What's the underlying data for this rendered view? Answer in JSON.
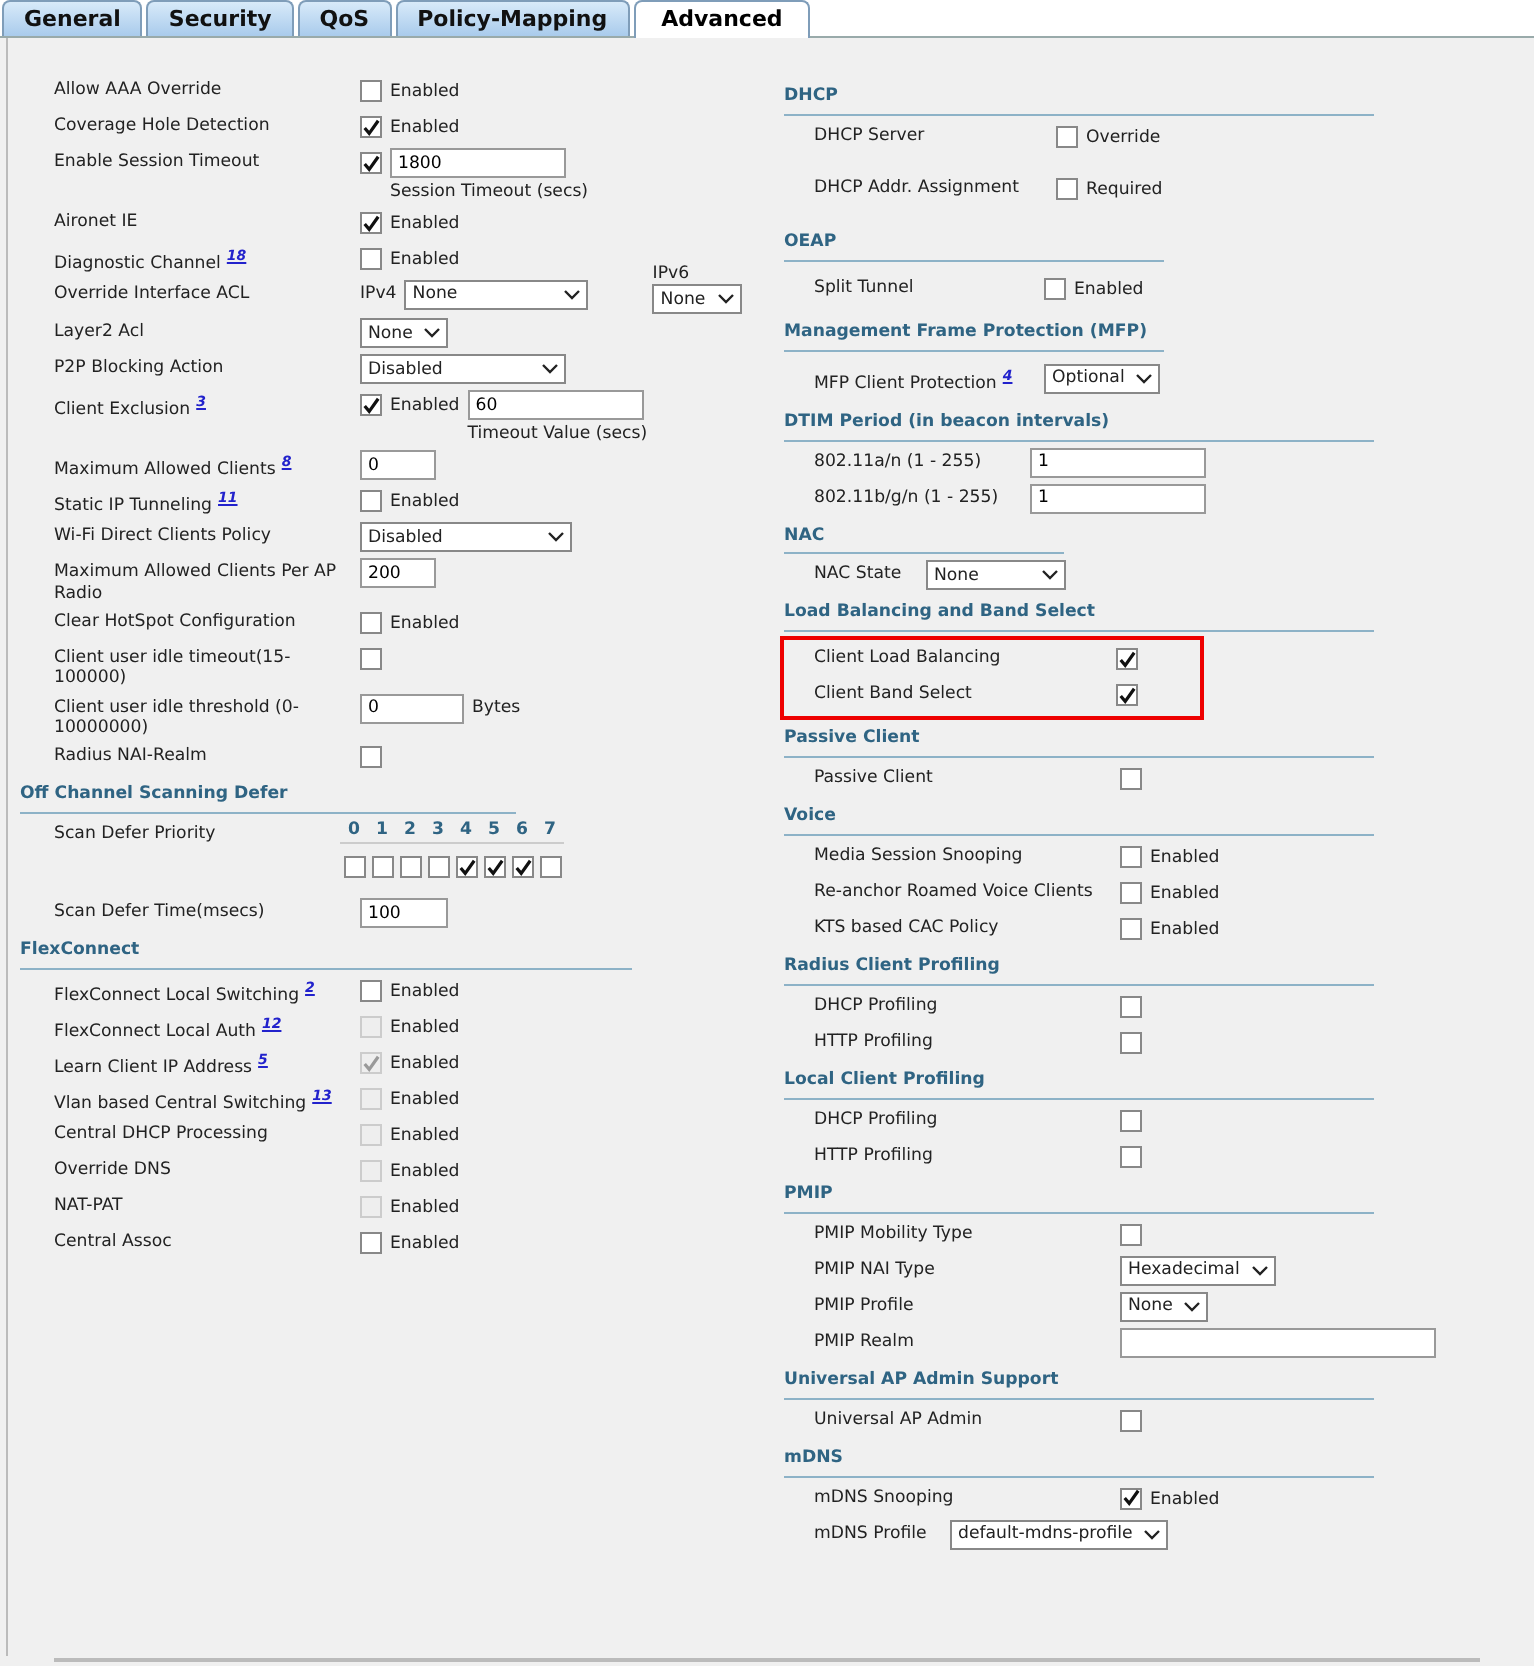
{
  "tabs": [
    {
      "label": "General",
      "selected": false
    },
    {
      "label": "Security",
      "selected": false
    },
    {
      "label": "QoS",
      "selected": false
    },
    {
      "label": "Policy-Mapping",
      "selected": false
    },
    {
      "label": "Advanced",
      "selected": true
    }
  ],
  "left_sections": [
    {
      "rows": [
        {
          "label": "Allow AAA Override",
          "controls": [
            {
              "kind": "checkbox",
              "checked": false,
              "text": "Enabled"
            }
          ]
        },
        {
          "label": "Coverage Hole Detection",
          "controls": [
            {
              "kind": "checkbox",
              "checked": true,
              "text": "Enabled"
            }
          ]
        },
        {
          "label": "Enable Session Timeout",
          "controls": [
            {
              "kind": "checkbox",
              "checked": true
            },
            {
              "kind": "input",
              "value": "1800",
              "caption": "Session Timeout (secs)"
            }
          ]
        },
        {
          "label": "Aironet IE",
          "controls": [
            {
              "kind": "checkbox",
              "checked": true,
              "text": "Enabled"
            }
          ]
        },
        {
          "label": "Diagnostic Channel",
          "note": "18",
          "controls": [
            {
              "kind": "checkbox",
              "checked": false,
              "text": "Enabled"
            }
          ]
        },
        {
          "label": "Override Interface ACL",
          "controls": [
            {
              "kind": "select",
              "prefix": "IPv4",
              "value": "None"
            },
            {
              "kind": "select",
              "caption_above": "IPv6",
              "value": "None"
            }
          ]
        },
        {
          "label": "Layer2 Acl",
          "controls": [
            {
              "kind": "select",
              "value": "None"
            }
          ]
        },
        {
          "label": "P2P Blocking Action",
          "controls": [
            {
              "kind": "select",
              "value": "Disabled"
            }
          ]
        },
        {
          "label": "Client Exclusion",
          "note": "3",
          "controls": [
            {
              "kind": "checkbox",
              "checked": true,
              "text": "Enabled"
            },
            {
              "kind": "input",
              "value": "60",
              "caption": "Timeout Value (secs)"
            }
          ]
        },
        {
          "label": "Maximum Allowed Clients",
          "note": "8",
          "controls": [
            {
              "kind": "input",
              "value": "0"
            }
          ]
        },
        {
          "label": "Static IP Tunneling",
          "note": "11",
          "controls": [
            {
              "kind": "checkbox",
              "checked": false,
              "text": "Enabled"
            }
          ]
        },
        {
          "label": "Wi-Fi Direct Clients Policy",
          "controls": [
            {
              "kind": "select",
              "value": "Disabled"
            }
          ]
        },
        {
          "label": "Maximum Allowed Clients Per AP Radio",
          "controls": [
            {
              "kind": "input",
              "value": "200"
            }
          ]
        },
        {
          "label": "Clear HotSpot Configuration",
          "controls": [
            {
              "kind": "checkbox",
              "checked": false,
              "text": "Enabled"
            }
          ]
        },
        {
          "label": "Client user idle timeout(15-100000)",
          "controls": [
            {
              "kind": "checkbox",
              "checked": false
            }
          ]
        },
        {
          "label": "Client user idle threshold (0-10000000)",
          "controls": [
            {
              "kind": "input",
              "value": "0",
              "suffix": "Bytes"
            }
          ]
        },
        {
          "label": "Radius NAI-Realm",
          "controls": [
            {
              "kind": "checkbox",
              "checked": false
            }
          ]
        }
      ]
    },
    {
      "title": "Off Channel Scanning Defer",
      "rows": [
        {
          "label": "Scan Defer Priority",
          "controls": [
            {
              "kind": "priorities",
              "items": [
                {
                  "label": "0",
                  "checked": false
                },
                {
                  "label": "1",
                  "checked": false
                },
                {
                  "label": "2",
                  "checked": false
                },
                {
                  "label": "3",
                  "checked": false
                },
                {
                  "label": "4",
                  "checked": true
                },
                {
                  "label": "5",
                  "checked": true
                },
                {
                  "label": "6",
                  "checked": true
                },
                {
                  "label": "7",
                  "checked": false
                }
              ]
            }
          ]
        },
        {
          "label": "Scan Defer Time(msecs)",
          "controls": [
            {
              "kind": "input",
              "value": "100"
            }
          ]
        }
      ]
    },
    {
      "title": "FlexConnect",
      "rows": [
        {
          "label": "FlexConnect Local Switching",
          "note": "2",
          "controls": [
            {
              "kind": "checkbox",
              "checked": false,
              "disabled": false,
              "text": "Enabled"
            }
          ]
        },
        {
          "label": "FlexConnect Local Auth",
          "note": "12",
          "controls": [
            {
              "kind": "checkbox",
              "checked": false,
              "disabled": true,
              "text": "Enabled"
            }
          ]
        },
        {
          "label": "Learn Client IP Address",
          "note": "5",
          "controls": [
            {
              "kind": "checkbox",
              "checked": true,
              "disabled": true,
              "text": "Enabled"
            }
          ]
        },
        {
          "label": "Vlan based Central Switching",
          "note": "13",
          "controls": [
            {
              "kind": "checkbox",
              "checked": false,
              "disabled": true,
              "text": "Enabled"
            }
          ]
        },
        {
          "label": "Central DHCP Processing",
          "controls": [
            {
              "kind": "checkbox",
              "checked": false,
              "disabled": true,
              "text": "Enabled"
            }
          ]
        },
        {
          "label": "Override DNS",
          "controls": [
            {
              "kind": "checkbox",
              "checked": false,
              "disabled": true,
              "text": "Enabled"
            }
          ]
        },
        {
          "label": "NAT-PAT",
          "controls": [
            {
              "kind": "checkbox",
              "checked": false,
              "disabled": true,
              "text": "Enabled"
            }
          ]
        },
        {
          "label": "Central Assoc",
          "controls": [
            {
              "kind": "checkbox",
              "checked": false,
              "disabled": false,
              "text": "Enabled"
            }
          ]
        }
      ]
    }
  ],
  "right_sections": [
    {
      "title": "DHCP",
      "rows": [
        {
          "label": "DHCP Server",
          "controls": [
            {
              "kind": "checkbox",
              "checked": false,
              "text": "Override"
            }
          ]
        },
        {
          "label": "DHCP Addr. Assignment",
          "controls": [
            {
              "kind": "checkbox",
              "checked": false,
              "text": "Required"
            }
          ]
        }
      ]
    },
    {
      "title": "OEAP",
      "rows": [
        {
          "label": "Split Tunnel",
          "controls": [
            {
              "kind": "checkbox",
              "checked": false,
              "text": "Enabled"
            }
          ]
        }
      ]
    },
    {
      "title": "Management Frame Protection (MFP)",
      "rows": [
        {
          "label": "MFP Client Protection",
          "note": "4",
          "controls": [
            {
              "kind": "select",
              "value": "Optional"
            }
          ]
        }
      ]
    },
    {
      "title": "DTIM Period (in beacon intervals)",
      "rows": [
        {
          "label": "802.11a/n (1 - 255)",
          "controls": [
            {
              "kind": "input",
              "value": "1"
            }
          ]
        },
        {
          "label": "802.11b/g/n (1 - 255)",
          "controls": [
            {
              "kind": "input",
              "value": "1"
            }
          ]
        }
      ]
    },
    {
      "title": "NAC",
      "rows": [
        {
          "label": "NAC State",
          "controls": [
            {
              "kind": "select",
              "value": "None"
            }
          ]
        }
      ]
    },
    {
      "title": "Load Balancing and Band Select",
      "highlighted": true,
      "rows": [
        {
          "label": "Client Load Balancing",
          "controls": [
            {
              "kind": "checkbox",
              "checked": true
            }
          ]
        },
        {
          "label": "Client Band Select",
          "controls": [
            {
              "kind": "checkbox",
              "checked": true
            }
          ]
        }
      ]
    },
    {
      "title": "Passive Client",
      "rows": [
        {
          "label": "Passive Client",
          "controls": [
            {
              "kind": "checkbox",
              "checked": false
            }
          ]
        }
      ]
    },
    {
      "title": "Voice",
      "rows": [
        {
          "label": "Media Session Snooping",
          "controls": [
            {
              "kind": "checkbox",
              "checked": false,
              "text": "Enabled"
            }
          ]
        },
        {
          "label": "Re-anchor Roamed Voice Clients",
          "controls": [
            {
              "kind": "checkbox",
              "checked": false,
              "text": "Enabled"
            }
          ]
        },
        {
          "label": "KTS based CAC Policy",
          "controls": [
            {
              "kind": "checkbox",
              "checked": false,
              "text": "Enabled"
            }
          ]
        }
      ]
    },
    {
      "title": "Radius Client Profiling",
      "rows": [
        {
          "label": "DHCP Profiling",
          "controls": [
            {
              "kind": "checkbox",
              "checked": false
            }
          ]
        },
        {
          "label": "HTTP Profiling",
          "controls": [
            {
              "kind": "checkbox",
              "checked": false
            }
          ]
        }
      ]
    },
    {
      "title": "Local Client Profiling",
      "rows": [
        {
          "label": "DHCP Profiling",
          "controls": [
            {
              "kind": "checkbox",
              "checked": false
            }
          ]
        },
        {
          "label": "HTTP Profiling",
          "controls": [
            {
              "kind": "checkbox",
              "checked": false
            }
          ]
        }
      ]
    },
    {
      "title": "PMIP",
      "rows": [
        {
          "label": "PMIP Mobility Type",
          "controls": [
            {
              "kind": "checkbox",
              "checked": false
            }
          ]
        },
        {
          "label": "PMIP NAI Type",
          "controls": [
            {
              "kind": "select",
              "value": "Hexadecimal"
            }
          ]
        },
        {
          "label": "PMIP Profile",
          "controls": [
            {
              "kind": "select",
              "value": "None"
            }
          ]
        },
        {
          "label": "PMIP Realm",
          "controls": [
            {
              "kind": "input"
            }
          ]
        }
      ]
    },
    {
      "title": "Universal AP Admin Support",
      "rows": [
        {
          "label": "Universal AP Admin",
          "controls": [
            {
              "kind": "checkbox",
              "checked": false
            }
          ]
        }
      ]
    },
    {
      "title": "mDNS",
      "rows": [
        {
          "label": "mDNS Snooping",
          "controls": [
            {
              "kind": "checkbox",
              "checked": true,
              "text": "Enabled"
            }
          ]
        },
        {
          "label": "mDNS Profile",
          "controls": [
            {
              "kind": "select",
              "value": "default-mdns-profile"
            }
          ]
        }
      ]
    }
  ]
}
